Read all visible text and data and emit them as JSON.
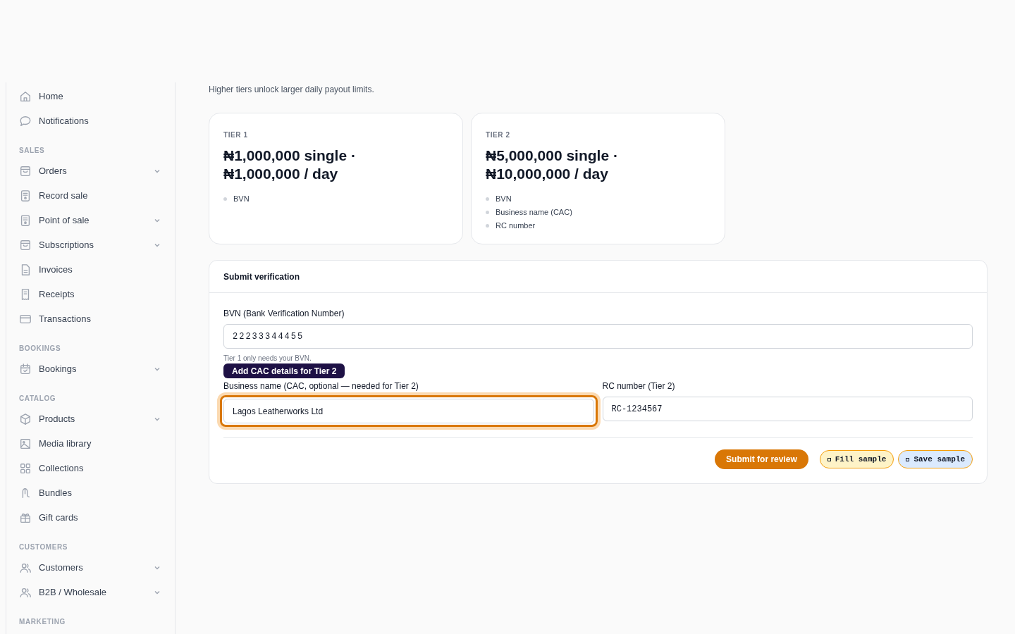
{
  "sidebar": {
    "sections": [
      {
        "items": [
          {
            "label": "Home",
            "expandable": false
          },
          {
            "label": "Notifications",
            "expandable": false
          }
        ]
      },
      {
        "heading": "SALES",
        "items": [
          {
            "label": "Orders",
            "expandable": true
          },
          {
            "label": "Record sale",
            "expandable": false
          },
          {
            "label": "Point of sale",
            "expandable": true
          },
          {
            "label": "Subscriptions",
            "expandable": true
          },
          {
            "label": "Invoices",
            "expandable": false
          },
          {
            "label": "Receipts",
            "expandable": false
          },
          {
            "label": "Transactions",
            "expandable": false
          }
        ]
      },
      {
        "heading": "BOOKINGS",
        "items": [
          {
            "label": "Bookings",
            "expandable": true
          }
        ]
      },
      {
        "heading": "CATALOG",
        "items": [
          {
            "label": "Products",
            "expandable": true
          },
          {
            "label": "Media library",
            "expandable": false
          },
          {
            "label": "Collections",
            "expandable": false
          },
          {
            "label": "Bundles",
            "expandable": false
          },
          {
            "label": "Gift cards",
            "expandable": false
          }
        ]
      },
      {
        "heading": "CUSTOMERS",
        "items": [
          {
            "label": "Customers",
            "expandable": true
          },
          {
            "label": "B2B / Wholesale",
            "expandable": true
          }
        ]
      },
      {
        "heading": "MARKETING"
      }
    ]
  },
  "intro": "Higher tiers unlock larger daily payout limits.",
  "tiers": [
    {
      "name": "TIER 1",
      "limit": "₦1,000,000 single · ₦1,000,000 / day",
      "requirements": [
        "BVN"
      ]
    },
    {
      "name": "TIER 2",
      "limit": "₦5,000,000 single · ₦10,000,000 / day",
      "requirements": [
        "BVN",
        "Business name (CAC)",
        "RC number"
      ]
    }
  ],
  "form": {
    "title": "Submit verification",
    "bvn": {
      "label": "BVN (Bank Verification Number)",
      "value": "22233344455",
      "hint": "Tier 1 only needs your BVN."
    },
    "tooltip": "Add CAC details for Tier 2",
    "business_name": {
      "label": "Business name (CAC, optional — needed for Tier 2)",
      "value": "Lagos Leatherworks Ltd",
      "highlighted": true
    },
    "rc_number": {
      "label": "RC number (Tier 2)",
      "value": "RC-1234567"
    },
    "buttons": [
      {
        "label": "Submit for review",
        "kind": "primary"
      },
      {
        "label": "Fill sample",
        "kind": "yellow"
      },
      {
        "label": "Save sample",
        "kind": "blue"
      }
    ]
  }
}
